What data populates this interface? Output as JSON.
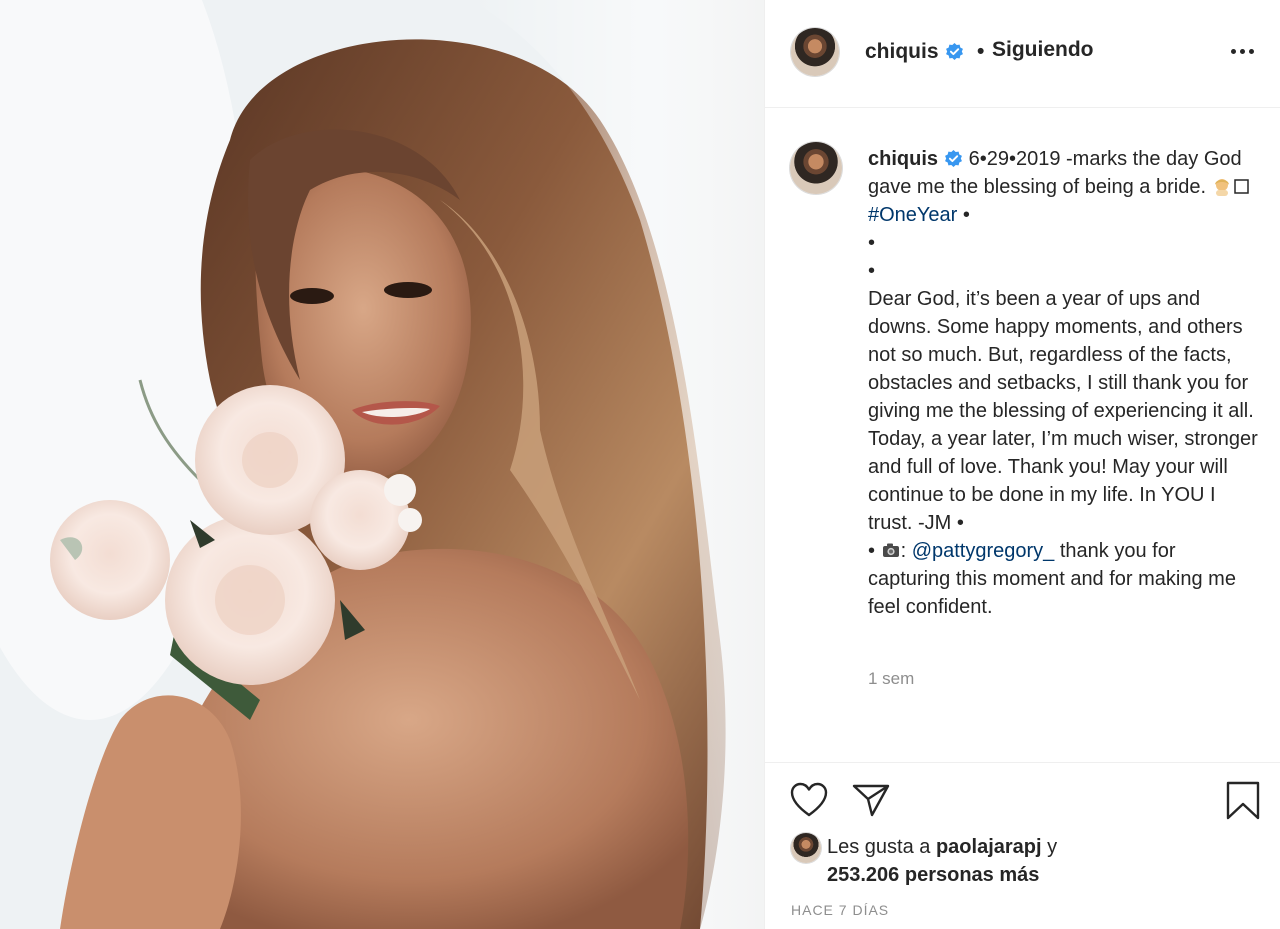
{
  "photo": {
    "subject": "bride-portrait"
  },
  "header": {
    "username": "chiquis",
    "separator": "•",
    "follow_status": "Siguiendo",
    "verified_color": "#3897f0"
  },
  "caption": {
    "username": "chiquis",
    "lines_intro": "6•29•2019 -marks the day God gave me the blessing of being a bride. ",
    "hashtag": "#OneYear",
    "after_hashtag": " •\n•\n•\nDear God, it’s been a year of ups and downs. Some happy moments, and others not so much. But, regardless of the facts, obstacles and setbacks, I still thank you for giving me the blessing of experiencing it all. Today, a year later, I’m much wiser, stronger and full of love. Thank you! May your will continue to be done in my life. In YOU I trust. -JM •\n• ",
    "camera_suffix": ": ",
    "mention": "@pattygregory_",
    "closing": " thank you for capturing this moment and for making me feel confident.",
    "time_ago": "1 sem"
  },
  "actions": {
    "likes_prefix": "Les gusta a ",
    "liker": "paolajarapj",
    "likes_joiner": " y",
    "likes_count": "253.206 personas más",
    "posted_ago": "HACE 7 DÍAS"
  },
  "colors": {
    "text": "#262626",
    "muted": "#8e8e8e",
    "link": "#00376b",
    "border": "#efefef"
  }
}
